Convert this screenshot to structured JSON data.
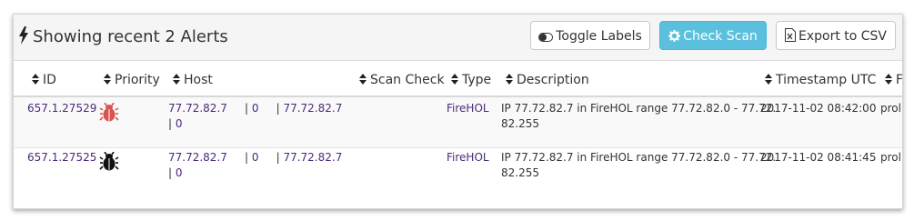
{
  "header": {
    "title": "Showing recent 2 Alerts",
    "buttons": {
      "toggle_labels": "Toggle Labels",
      "check_scan": "Check Scan",
      "export_csv": "Export to CSV"
    }
  },
  "columns": {
    "id": "ID",
    "priority": "Priority",
    "host": "Host",
    "scan_check": "Scan Check",
    "type": "Type",
    "description": "Description",
    "timestamp": "Timestamp UTC",
    "extra": "F"
  },
  "rows": [
    {
      "id": "657.1.27529",
      "priority_icon": "bug-icon",
      "priority_color": "#d9534f",
      "host_ip1": "77.72.82.7",
      "host_sep1": "|",
      "host_port1": "0",
      "host_sep2": "|",
      "host_ip2": "77.72.82.7",
      "host_sep3": "|",
      "host_port2": "0",
      "type": "FireHOL",
      "description_line1": "IP 77.72.82.7 in FireHOL range 77.72.82.0 - 77.72.",
      "description_line2": "82.255",
      "timestamp": "2017-11-02 08:42:00",
      "extra": "prol"
    },
    {
      "id": "657.1.27525",
      "priority_icon": "bug-icon",
      "priority_color": "#111111",
      "host_ip1": "77.72.82.7",
      "host_sep1": "|",
      "host_port1": "0",
      "host_sep2": "|",
      "host_ip2": "77.72.82.7",
      "host_sep3": "|",
      "host_port2": "0",
      "type": "FireHOL",
      "description_line1": "IP 77.72.82.7 in FireHOL range 77.72.82.0 - 77.72.",
      "description_line2": "82.255",
      "timestamp": "2017-11-02 08:41:45",
      "extra": "prol"
    }
  ],
  "colors": {
    "link": "#4b2a7b",
    "info_button": "#5bc0de",
    "header_bg": "#f5f5f5"
  }
}
